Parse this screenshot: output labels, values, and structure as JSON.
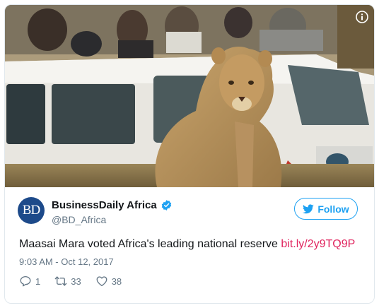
{
  "tweet": {
    "display_name": "BusinessDaily Africa",
    "handle": "@BD_Africa",
    "avatar_text": "BD",
    "follow_label": "Follow",
    "text": "Maasai Mara voted Africa's leading national reserve",
    "link_text": "bit.ly/2y9TQ9P",
    "timestamp": "9:03 AM - Oct 12, 2017",
    "reply_count": "1",
    "retweet_count": "33",
    "like_count": "38"
  },
  "colors": {
    "accent": "#1da1f2",
    "link": "#e0245e",
    "secondary_text": "#657786",
    "avatar_bg": "#1d4a8a"
  },
  "icons": [
    "info-icon",
    "verified-icon",
    "twitter-bird-icon",
    "reply-icon",
    "retweet-icon",
    "like-icon"
  ]
}
